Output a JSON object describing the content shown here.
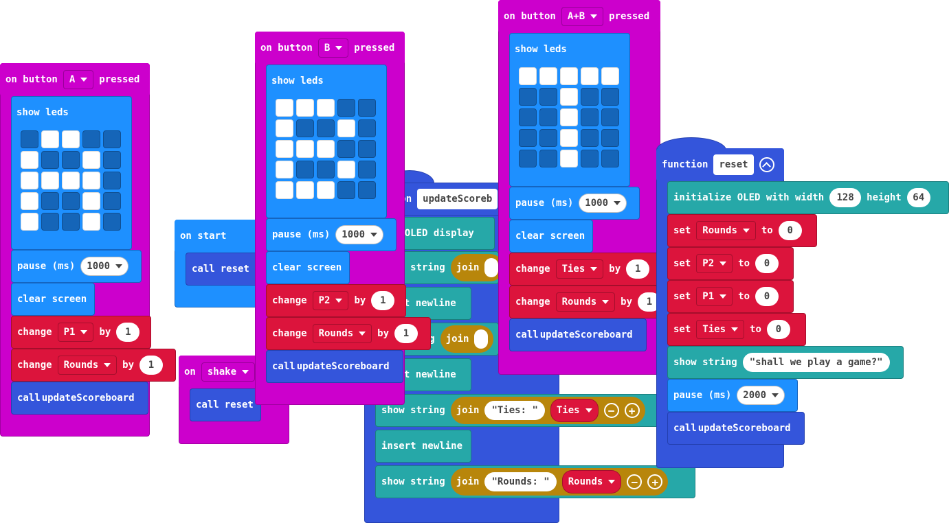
{
  "kw": {
    "on_button": "on button",
    "pressed": "pressed",
    "show_leds": "show leds",
    "pause_ms": "pause (ms)",
    "clear_screen": "clear screen",
    "change": "change",
    "by": "by",
    "call": "call",
    "on_start": "on start",
    "on": "on",
    "function": "function",
    "set": "set",
    "to": "to",
    "show_string": "show string",
    "join": "join",
    "insert_newline": "insert newline",
    "clear_oled": "clear OLED display",
    "init_oled": "initialize OLED with width",
    "height": "height"
  },
  "groupA": {
    "button": "A",
    "pause": "1000",
    "var1": "P1",
    "val1": "1",
    "var2": "Rounds",
    "val2": "1",
    "fn": "updateScoreboard",
    "leds": [
      0,
      1,
      1,
      0,
      0,
      1,
      0,
      0,
      1,
      0,
      1,
      1,
      1,
      1,
      0,
      1,
      0,
      0,
      1,
      0,
      1,
      0,
      0,
      1,
      0
    ]
  },
  "groupB": {
    "button": "B",
    "pause": "1000",
    "var1": "P2",
    "val1": "1",
    "var2": "Rounds",
    "val2": "1",
    "fn": "updateScoreboard",
    "leds": [
      1,
      1,
      1,
      0,
      0,
      1,
      0,
      0,
      1,
      0,
      1,
      1,
      1,
      0,
      0,
      1,
      0,
      0,
      1,
      0,
      1,
      1,
      1,
      0,
      0
    ]
  },
  "groupAB": {
    "button": "A+B",
    "pause": "1000",
    "var1": "Ties",
    "val1": "1",
    "var2": "Rounds",
    "val2": "1",
    "fn": "updateScoreboard",
    "leds": [
      1,
      1,
      1,
      1,
      1,
      0,
      0,
      1,
      0,
      0,
      0,
      0,
      1,
      0,
      0,
      0,
      0,
      1,
      0,
      0,
      0,
      0,
      1,
      0,
      0
    ]
  },
  "start": {
    "fn": "reset"
  },
  "shake": {
    "event": "shake",
    "fn": "reset"
  },
  "updateFn": {
    "name": "updateScoreb",
    "ties_label": "\"Ties: \"",
    "ties_var": "Ties",
    "rounds_label": "\"Rounds: \"",
    "rounds_var": "Rounds",
    "clear_partial": "ear OLED display",
    "insert_partial": "ert newline",
    "string_partial": "ring",
    "join_label": "join"
  },
  "resetFn": {
    "name": "reset",
    "width": "128",
    "height": "64",
    "sets": [
      {
        "var": "Rounds",
        "val": "0"
      },
      {
        "var": "P2",
        "val": "0"
      },
      {
        "var": "P1",
        "val": "0"
      },
      {
        "var": "Ties",
        "val": "0"
      }
    ],
    "string": "\"shall we play a game?\"",
    "pause": "2000",
    "call_fn": "updateScoreboard"
  },
  "colors": {
    "input": "#cc00cc",
    "basic": "#1e90ff",
    "variables": "#dc143c",
    "oled": "#26a8a8",
    "functions": "#3455db",
    "text": "#b8860b"
  }
}
